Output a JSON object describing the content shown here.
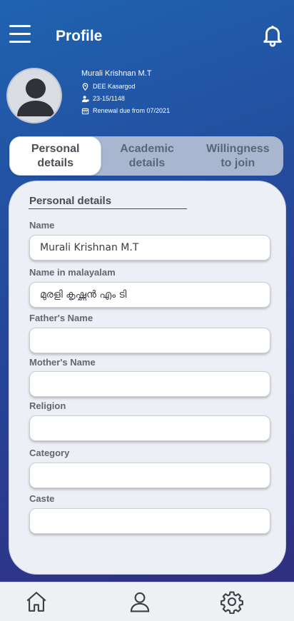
{
  "header": {
    "title": "Profile",
    "menu_icon": "menu-icon",
    "notification_icon": "bell-icon"
  },
  "profile": {
    "name": "Murali Krishnan M.T",
    "location": "DEE Kasargod",
    "registration": "23-15/1148",
    "renewal": "Renewal due from 07/2021",
    "icons": [
      "location-pin-icon",
      "person-id-icon",
      "calendar-icon"
    ]
  },
  "tabs": [
    {
      "label": "Personal\ndetails",
      "active": true
    },
    {
      "label": "Academic\ndetails",
      "active": false
    },
    {
      "label": "Willingness\nto join",
      "active": false
    }
  ],
  "form": {
    "section_title": "Personal details",
    "fields": [
      {
        "label": "Name",
        "value": "Murali Krishnan M.T"
      },
      {
        "label": "Name in malayalam",
        "value": "മുരളി കൃഷ്ണൻ എം ടി"
      },
      {
        "label": "Father's Name",
        "value": ""
      },
      {
        "label": "Mother's Name",
        "value": ""
      },
      {
        "label": "Religion",
        "value": ""
      },
      {
        "label": "Category",
        "value": ""
      },
      {
        "label": "Caste",
        "value": ""
      }
    ]
  },
  "bottom_nav": {
    "items": [
      "home-icon",
      "user-icon",
      "settings-icon"
    ]
  },
  "colors": {
    "bg_top": "#1f63b0",
    "bg_bottom": "#322c7e",
    "card": "#eceff5",
    "tab_track": "#a9b6cf"
  }
}
